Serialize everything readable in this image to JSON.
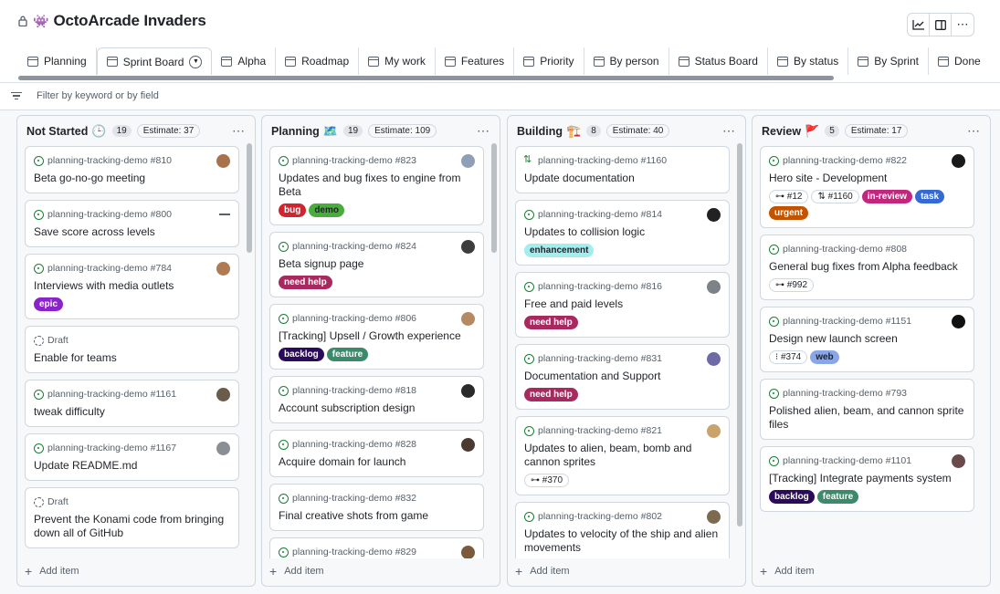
{
  "app": {
    "title": "OctoArcade Invaders"
  },
  "toolbar": {
    "insights_icon": "graph-icon",
    "layout_icon": "sidebar-icon",
    "more": "⋯"
  },
  "tabs": [
    {
      "label": "Planning"
    },
    {
      "label": "Sprint Board",
      "active": true
    },
    {
      "label": "Alpha"
    },
    {
      "label": "Roadmap"
    },
    {
      "label": "My work"
    },
    {
      "label": "Features"
    },
    {
      "label": "Priority"
    },
    {
      "label": "By person"
    },
    {
      "label": "Status Board"
    },
    {
      "label": "By status"
    },
    {
      "label": "By Sprint"
    },
    {
      "label": "Done"
    }
  ],
  "filter": {
    "placeholder": "Filter by keyword or by field"
  },
  "columns": [
    {
      "name": "Not Started",
      "emoji": "🕒",
      "count": "19",
      "estimate": "Estimate: 37",
      "cards": [
        {
          "meta": "planning-tracking-demo #810",
          "title": "Beta go-no-go meeting",
          "state": "open",
          "avatar": "#a8724d"
        },
        {
          "meta": "planning-tracking-demo #800",
          "title": "Save score across levels",
          "state": "open",
          "avatar": "dash"
        },
        {
          "meta": "planning-tracking-demo #784",
          "title": "Interviews with media outlets",
          "state": "open",
          "avatar": "#b07a55",
          "labels": [
            {
              "text": "epic",
              "color": "#8a23c9"
            }
          ]
        },
        {
          "meta": "Draft",
          "title": "Enable for teams",
          "state": "draft"
        },
        {
          "meta": "planning-tracking-demo #1161",
          "title": "tweak difficulty",
          "state": "open",
          "avatar": "#6b5b4b"
        },
        {
          "meta": "planning-tracking-demo #1167",
          "title": "Update README.md",
          "state": "open",
          "avatar": "#8a8f96"
        },
        {
          "meta": "Draft",
          "title": "Prevent the Konami code from bringing down all of GitHub",
          "state": "draft"
        }
      ]
    },
    {
      "name": "Planning",
      "emoji": "🗺️",
      "count": "19",
      "estimate": "Estimate: 109",
      "cards": [
        {
          "meta": "planning-tracking-demo #823",
          "title": "Updates and bug fixes to engine from Beta",
          "state": "open",
          "avatar": "#8f9fb5",
          "labels": [
            {
              "text": "bug",
              "color": "#d1242f"
            },
            {
              "text": "demo",
              "color": "#4aac3c",
              "dark": true
            }
          ]
        },
        {
          "meta": "planning-tracking-demo #824",
          "title": "Beta signup page",
          "state": "open",
          "avatar": "#3d3d3d",
          "labels": [
            {
              "text": "need help",
              "color": "#a8295f"
            }
          ]
        },
        {
          "meta": "planning-tracking-demo #806",
          "title": "[Tracking] Upsell / Growth experience",
          "state": "open",
          "avatar": "#b58a63",
          "labels": [
            {
              "text": "backlog",
              "color": "#2c0a5b"
            },
            {
              "text": "feature",
              "color": "#3b8a6a"
            }
          ]
        },
        {
          "meta": "planning-tracking-demo #818",
          "title": "Account subscription design",
          "state": "open",
          "avatar": "#2a2a2a"
        },
        {
          "meta": "planning-tracking-demo #828",
          "title": "Acquire domain for launch",
          "state": "open",
          "avatar": "#4b3a32"
        },
        {
          "meta": "planning-tracking-demo #832",
          "title": "Final creative shots from game",
          "state": "open"
        },
        {
          "meta": "planning-tracking-demo #829",
          "title": "",
          "state": "open",
          "avatar": "#7a5a3a"
        }
      ]
    },
    {
      "name": "Building",
      "emoji": "🏗️",
      "count": "8",
      "estimate": "Estimate: 40",
      "cards": [
        {
          "meta": "planning-tracking-demo #1160",
          "title": "Update documentation",
          "state": "pr"
        },
        {
          "meta": "planning-tracking-demo #814",
          "title": "Updates to collision logic",
          "state": "open",
          "avatar": "#222",
          "labels": [
            {
              "text": "enhancement",
              "color": "#a2eeef",
              "dark": true
            }
          ]
        },
        {
          "meta": "planning-tracking-demo #816",
          "title": "Free and paid levels",
          "state": "open",
          "avatar": "#7d8288",
          "labels": [
            {
              "text": "need help",
              "color": "#a8295f"
            }
          ]
        },
        {
          "meta": "planning-tracking-demo #831",
          "title": "Documentation and Support",
          "state": "open",
          "avatar": "#6e6aa5",
          "labels": [
            {
              "text": "need help",
              "color": "#a8295f"
            }
          ]
        },
        {
          "meta": "planning-tracking-demo #821",
          "title": "Updates to alien, beam, bomb and cannon sprites",
          "state": "open",
          "avatar": "#c9a36a",
          "refs": [
            "⊶ #370"
          ]
        },
        {
          "meta": "planning-tracking-demo #802",
          "title": "Updates to velocity of the ship and alien movements",
          "state": "open",
          "avatar": "#7b6a4f"
        }
      ]
    },
    {
      "name": "Review",
      "emoji": "🚩",
      "count": "5",
      "estimate": "Estimate: 17",
      "cards": [
        {
          "meta": "planning-tracking-demo #822",
          "title": "Hero site - Development",
          "state": "open",
          "avatar": "#1a1a1a",
          "refs": [
            "⊶ #12",
            "⇅ #1160"
          ],
          "labels": [
            {
              "text": "in-review",
              "color": "#c0277d"
            },
            {
              "text": "task",
              "color": "#3569d4"
            },
            {
              "text": "urgent",
              "color": "#c25400"
            }
          ]
        },
        {
          "meta": "planning-tracking-demo #808",
          "title": "General bug fixes from Alpha feedback",
          "state": "open",
          "refs": [
            "⊶ #992"
          ]
        },
        {
          "meta": "planning-tracking-demo #1151",
          "title": "Design new launch screen",
          "state": "open",
          "avatar": "#111",
          "refs": [
            "⁝ #374"
          ],
          "labels": [
            {
              "text": "web",
              "color": "#89a6e6",
              "dark": true
            }
          ]
        },
        {
          "meta": "planning-tracking-demo #793",
          "title": "Polished alien, beam, and cannon sprite files",
          "state": "open"
        },
        {
          "meta": "planning-tracking-demo #1101",
          "title": "[Tracking] Integrate payments system",
          "state": "open",
          "avatar": "#6a4b4b",
          "labels": [
            {
              "text": "backlog",
              "color": "#2c0a5b"
            },
            {
              "text": "feature",
              "color": "#3b8a6a"
            }
          ]
        }
      ]
    }
  ],
  "add_item": "Add item"
}
